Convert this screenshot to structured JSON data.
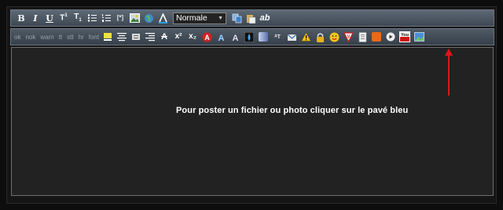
{
  "toolbar_top": {
    "bold": "B",
    "italic": "I",
    "underline": "U",
    "bullet_list_label": "",
    "format_select": "Normale",
    "spell_label": "ab"
  },
  "toolbar_bottom": {
    "labels": [
      "ok",
      "nok",
      "warn",
      "tt",
      "stt",
      "hr",
      "font"
    ],
    "superscript": "x²",
    "subscript": "x₂",
    "youtube": "You"
  },
  "editor": {
    "annotation": "Pour poster un fichier ou photo cliquer sur le pavé bleu"
  },
  "colors": {
    "toolbar": "#4b5661",
    "editor_bg": "#222222",
    "arrow": "#e0151b",
    "annotation": "#ffffff"
  }
}
